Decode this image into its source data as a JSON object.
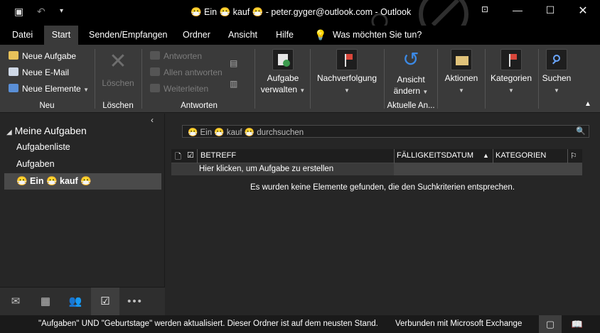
{
  "titlebar": {
    "title": "😷 Ein 😷 kauf 😷 - peter.gyger@outlook.com  -  Outlook",
    "icons": [
      "outlook-app-icon",
      "undo-icon",
      "quick-access-dropdown-icon",
      "ribbon-display-options-icon",
      "minimize-icon",
      "maximize-icon",
      "close-icon"
    ]
  },
  "tabs": [
    "Datei",
    "Start",
    "Senden/Empfangen",
    "Ordner",
    "Ansicht",
    "Hilfe"
  ],
  "tellme": "Was möchten Sie tun?",
  "ribbon": {
    "neu": {
      "items": [
        "Neue Aufgabe",
        "Neue E-Mail",
        "Neue Elemente"
      ],
      "label": "Neu"
    },
    "loeschen": {
      "button": "Löschen",
      "label": "Löschen"
    },
    "antworten": {
      "items": [
        "Antworten",
        "Allen antworten",
        "Weiterleiten"
      ],
      "label": "Antworten"
    },
    "aufgabe_verwalten": {
      "line1": "Aufgabe",
      "line2": "verwalten"
    },
    "nachverfolgung": "Nachverfolgung",
    "ansicht_aendern": {
      "line1": "Ansicht",
      "line2": "ändern",
      "label": "Aktuelle An..."
    },
    "aktionen": "Aktionen",
    "kategorien": "Kategorien",
    "suchen": "Suchen"
  },
  "leftnav": {
    "header": "Meine Aufgaben",
    "items": [
      "Aufgabenliste",
      "Aufgaben"
    ],
    "selected": "😷 Ein 😷 kauf 😷"
  },
  "search": {
    "placeholder": "😷 Ein 😷 kauf 😷 durchsuchen"
  },
  "columns": [
    "BETREFF",
    "FÄLLIGKEITSDATUM",
    "KATEGORIEN"
  ],
  "new_task_row": "Hier klicken, um Aufgabe zu erstellen",
  "empty_message": "Es wurden keine Elemente gefunden, die den Suchkriterien entsprechen.",
  "statusbar": {
    "left": "\"Aufgaben\" UND \"Geburtstage\" werden aktualisiert.  Dieser Ordner ist auf dem neusten Stand.",
    "right": "Verbunden mit Microsoft Exchange"
  },
  "colors": {
    "accent_blue": "#3c8ae6",
    "flag_red": "#d9463a",
    "background": "#262626",
    "titlebar": "#000000"
  }
}
